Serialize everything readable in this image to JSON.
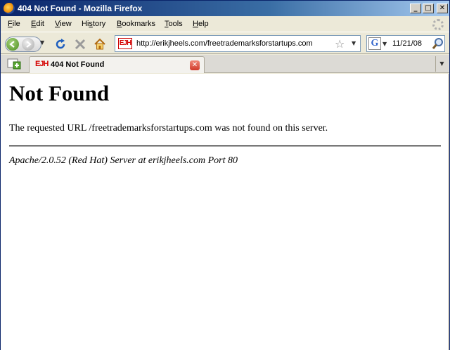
{
  "window": {
    "title": "404 Not Found - Mozilla Firefox",
    "controls": {
      "minimize": "_",
      "maximize": "□",
      "close": "✕"
    }
  },
  "menubar": {
    "items": [
      {
        "label": "File",
        "accel": "F"
      },
      {
        "label": "Edit",
        "accel": "E"
      },
      {
        "label": "View",
        "accel": "V"
      },
      {
        "label": "History",
        "accel": "s"
      },
      {
        "label": "Bookmarks",
        "accel": "B"
      },
      {
        "label": "Tools",
        "accel": "T"
      },
      {
        "label": "Help",
        "accel": "H"
      }
    ]
  },
  "navbar": {
    "url": "http://erikjheels.com/freetrademarksforstartups.com",
    "site_favicon_text": "EJH",
    "search_value": "11/21/08",
    "search_engine_letter": "G"
  },
  "tabs": [
    {
      "label": "404 Not Found",
      "favicon_text": "EJH",
      "active": true
    }
  ],
  "page": {
    "heading": "Not Found",
    "message": "The requested URL /freetrademarksforstartups.com was not found on this server.",
    "server_signature": "Apache/2.0.52 (Red Hat) Server at erikjheels.com Port 80"
  },
  "colors": {
    "titlebar_start": "#0a246a",
    "titlebar_end": "#a6caf0",
    "chrome_bg": "#ece9d8",
    "page_bg": "#ffffff",
    "favicon_red": "#d40000"
  }
}
